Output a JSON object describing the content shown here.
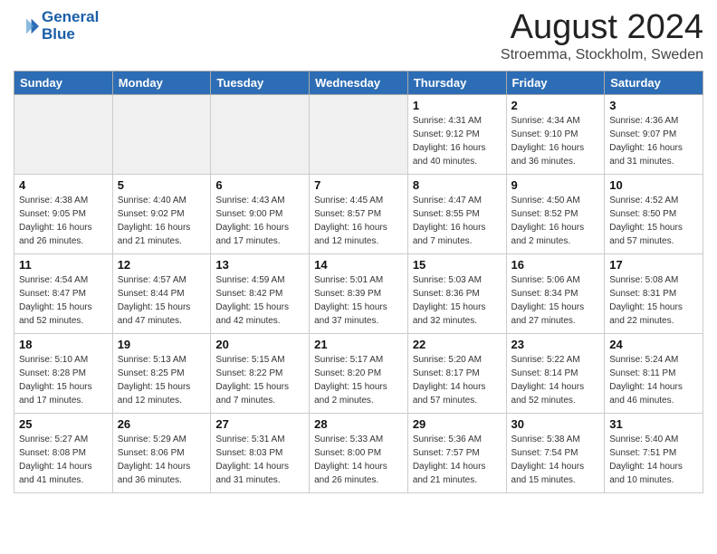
{
  "header": {
    "logo_line1": "General",
    "logo_line2": "Blue",
    "main_title": "August 2024",
    "subtitle": "Stroemma, Stockholm, Sweden"
  },
  "days_of_week": [
    "Sunday",
    "Monday",
    "Tuesday",
    "Wednesday",
    "Thursday",
    "Friday",
    "Saturday"
  ],
  "weeks": [
    [
      {
        "day": "",
        "empty": true
      },
      {
        "day": "",
        "empty": true
      },
      {
        "day": "",
        "empty": true
      },
      {
        "day": "",
        "empty": true
      },
      {
        "day": "1",
        "sunrise": "4:31 AM",
        "sunset": "9:12 PM",
        "daylight": "16 hours and 40 minutes."
      },
      {
        "day": "2",
        "sunrise": "4:34 AM",
        "sunset": "9:10 PM",
        "daylight": "16 hours and 36 minutes."
      },
      {
        "day": "3",
        "sunrise": "4:36 AM",
        "sunset": "9:07 PM",
        "daylight": "16 hours and 31 minutes."
      }
    ],
    [
      {
        "day": "4",
        "sunrise": "4:38 AM",
        "sunset": "9:05 PM",
        "daylight": "16 hours and 26 minutes."
      },
      {
        "day": "5",
        "sunrise": "4:40 AM",
        "sunset": "9:02 PM",
        "daylight": "16 hours and 21 minutes."
      },
      {
        "day": "6",
        "sunrise": "4:43 AM",
        "sunset": "9:00 PM",
        "daylight": "16 hours and 17 minutes."
      },
      {
        "day": "7",
        "sunrise": "4:45 AM",
        "sunset": "8:57 PM",
        "daylight": "16 hours and 12 minutes."
      },
      {
        "day": "8",
        "sunrise": "4:47 AM",
        "sunset": "8:55 PM",
        "daylight": "16 hours and 7 minutes."
      },
      {
        "day": "9",
        "sunrise": "4:50 AM",
        "sunset": "8:52 PM",
        "daylight": "16 hours and 2 minutes."
      },
      {
        "day": "10",
        "sunrise": "4:52 AM",
        "sunset": "8:50 PM",
        "daylight": "15 hours and 57 minutes."
      }
    ],
    [
      {
        "day": "11",
        "sunrise": "4:54 AM",
        "sunset": "8:47 PM",
        "daylight": "15 hours and 52 minutes."
      },
      {
        "day": "12",
        "sunrise": "4:57 AM",
        "sunset": "8:44 PM",
        "daylight": "15 hours and 47 minutes."
      },
      {
        "day": "13",
        "sunrise": "4:59 AM",
        "sunset": "8:42 PM",
        "daylight": "15 hours and 42 minutes."
      },
      {
        "day": "14",
        "sunrise": "5:01 AM",
        "sunset": "8:39 PM",
        "daylight": "15 hours and 37 minutes."
      },
      {
        "day": "15",
        "sunrise": "5:03 AM",
        "sunset": "8:36 PM",
        "daylight": "15 hours and 32 minutes."
      },
      {
        "day": "16",
        "sunrise": "5:06 AM",
        "sunset": "8:34 PM",
        "daylight": "15 hours and 27 minutes."
      },
      {
        "day": "17",
        "sunrise": "5:08 AM",
        "sunset": "8:31 PM",
        "daylight": "15 hours and 22 minutes."
      }
    ],
    [
      {
        "day": "18",
        "sunrise": "5:10 AM",
        "sunset": "8:28 PM",
        "daylight": "15 hours and 17 minutes."
      },
      {
        "day": "19",
        "sunrise": "5:13 AM",
        "sunset": "8:25 PM",
        "daylight": "15 hours and 12 minutes."
      },
      {
        "day": "20",
        "sunrise": "5:15 AM",
        "sunset": "8:22 PM",
        "daylight": "15 hours and 7 minutes."
      },
      {
        "day": "21",
        "sunrise": "5:17 AM",
        "sunset": "8:20 PM",
        "daylight": "15 hours and 2 minutes."
      },
      {
        "day": "22",
        "sunrise": "5:20 AM",
        "sunset": "8:17 PM",
        "daylight": "14 hours and 57 minutes."
      },
      {
        "day": "23",
        "sunrise": "5:22 AM",
        "sunset": "8:14 PM",
        "daylight": "14 hours and 52 minutes."
      },
      {
        "day": "24",
        "sunrise": "5:24 AM",
        "sunset": "8:11 PM",
        "daylight": "14 hours and 46 minutes."
      }
    ],
    [
      {
        "day": "25",
        "sunrise": "5:27 AM",
        "sunset": "8:08 PM",
        "daylight": "14 hours and 41 minutes."
      },
      {
        "day": "26",
        "sunrise": "5:29 AM",
        "sunset": "8:06 PM",
        "daylight": "14 hours and 36 minutes."
      },
      {
        "day": "27",
        "sunrise": "5:31 AM",
        "sunset": "8:03 PM",
        "daylight": "14 hours and 31 minutes."
      },
      {
        "day": "28",
        "sunrise": "5:33 AM",
        "sunset": "8:00 PM",
        "daylight": "14 hours and 26 minutes."
      },
      {
        "day": "29",
        "sunrise": "5:36 AM",
        "sunset": "7:57 PM",
        "daylight": "14 hours and 21 minutes."
      },
      {
        "day": "30",
        "sunrise": "5:38 AM",
        "sunset": "7:54 PM",
        "daylight": "14 hours and 15 minutes."
      },
      {
        "day": "31",
        "sunrise": "5:40 AM",
        "sunset": "7:51 PM",
        "daylight": "14 hours and 10 minutes."
      }
    ]
  ],
  "labels": {
    "sunrise_prefix": "Sunrise: ",
    "sunset_prefix": "Sunset: ",
    "daylight_prefix": "Daylight: "
  }
}
